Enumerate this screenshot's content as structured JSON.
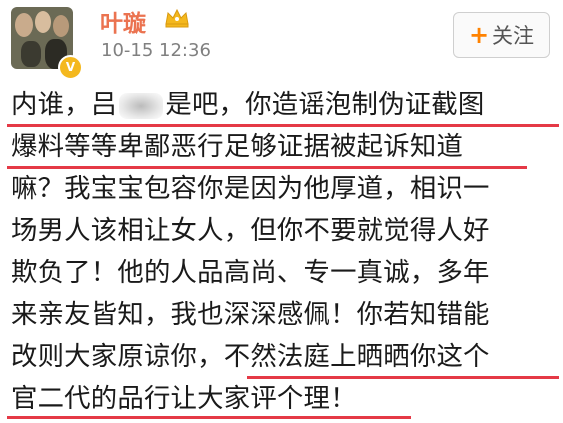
{
  "post_header": {
    "username": "叶璇",
    "timestamp": "10-15 12:36",
    "follow_label": "关注",
    "follow_icon": "plus-icon",
    "verified_icon": "verified-v-icon",
    "member_icon": "crown-icon",
    "verified_mark": "V"
  },
  "post_body": {
    "lines": [
      {
        "before": "内谁，吕",
        "after": "是吧，你造谣泡制伪证截图"
      },
      "爆料等等卑鄙恶行足够证据被起诉知道",
      "嘛？我宝宝包容你是因为他厚道，相识一",
      "场男人该相让女人，但你不要就觉得人好",
      "欺负了！他的人品高尚、专一真诚，多年",
      "来亲友皆知，我也深深感佩！你若知错能",
      "改则大家原谅你，不然法庭上晒晒你这个",
      "官二代的品行让大家评个理！"
    ],
    "highlight_color": "#e53946"
  },
  "colors": {
    "username": "#eb7350",
    "timestamp": "#808080",
    "follow_plus": "#ff8200",
    "badge": "#f4b81e"
  }
}
